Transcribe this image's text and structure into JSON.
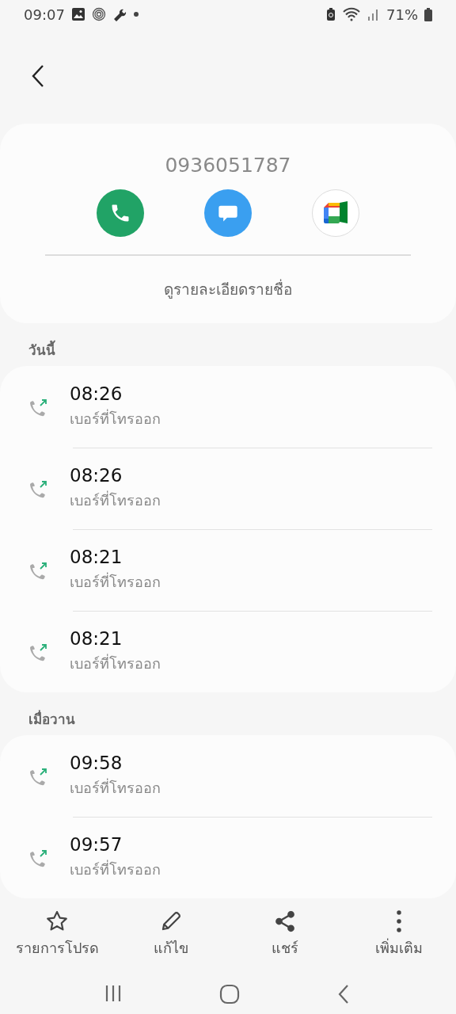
{
  "status_bar": {
    "time": "09:07",
    "battery": "71%"
  },
  "contact": {
    "number": "0936051787",
    "details_link": "ดูรายละเอียดรายชื่อ"
  },
  "sections": [
    {
      "header": "วันนี้",
      "calls": [
        {
          "time": "08:26",
          "type": "เบอร์ที่โทรออก"
        },
        {
          "time": "08:26",
          "type": "เบอร์ที่โทรออก"
        },
        {
          "time": "08:21",
          "type": "เบอร์ที่โทรออก"
        },
        {
          "time": "08:21",
          "type": "เบอร์ที่โทรออก"
        }
      ]
    },
    {
      "header": "เมื่อวาน",
      "calls": [
        {
          "time": "09:58",
          "type": "เบอร์ที่โทรออก"
        },
        {
          "time": "09:57",
          "type": "เบอร์ที่โทรออก"
        }
      ]
    }
  ],
  "bottom_actions": [
    {
      "kind": "favorite",
      "label": "รายการโปรด"
    },
    {
      "kind": "edit",
      "label": "แก้ไข"
    },
    {
      "kind": "share",
      "label": "แชร์"
    },
    {
      "kind": "more",
      "label": "เพิ่มเติม"
    }
  ]
}
